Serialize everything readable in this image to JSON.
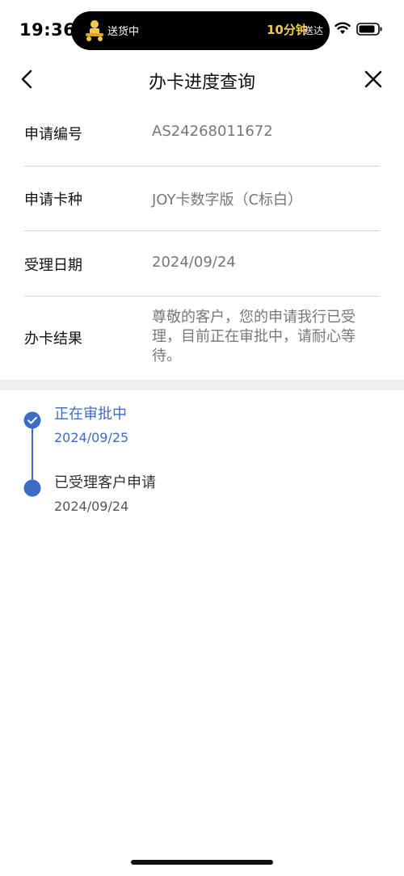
{
  "status_bar": {
    "time": "19:36",
    "delivery_status": "送货中",
    "eta_minutes": "10分钟",
    "eta_suffix": "送达"
  },
  "nav": {
    "title": "办卡进度查询",
    "back_icon": "chevron-left-icon",
    "close_icon": "close-icon"
  },
  "info": {
    "application_no": {
      "label": "申请编号",
      "value": "AS24268011672"
    },
    "card_type": {
      "label": "申请卡种",
      "value": "JOY卡数字版（C标白）"
    },
    "accept_date": {
      "label": "受理日期",
      "value": "2024/09/24"
    },
    "result": {
      "label": "办卡结果",
      "line1": "尊敬的客户，您的申请我行已受",
      "line2": "理，目前正在审批中，请耐心等",
      "line3": "待。"
    }
  },
  "timeline": [
    {
      "title": "正在审批中",
      "date": "2024/09/25",
      "active": true
    },
    {
      "title": "已受理客户申请",
      "date": "2024/09/24",
      "active": false
    }
  ],
  "colors": {
    "accent": "#3d6cc6",
    "label": "#111111",
    "value": "#777777",
    "divider": "#d4d4d4",
    "section_gap": "#efefef",
    "eta": "#f2c94c"
  }
}
